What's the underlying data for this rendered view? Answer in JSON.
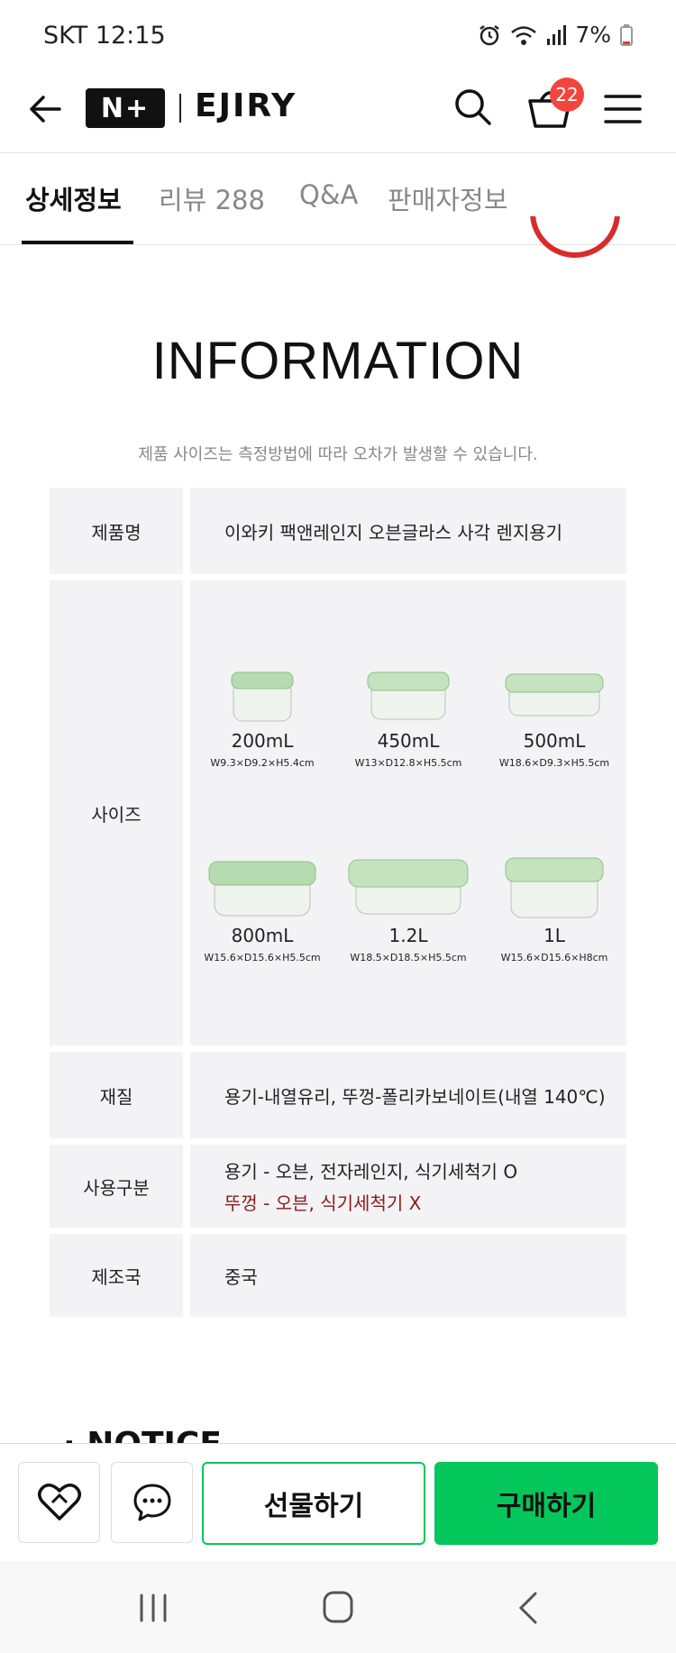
{
  "status": {
    "carrier_time": "SKT 12:15",
    "battery": "7%"
  },
  "header": {
    "brand_badge": "N+",
    "store_name": "EJIRY",
    "cart_count": "22"
  },
  "tabs": [
    {
      "label": "상세정보"
    },
    {
      "label": "리뷰 288"
    },
    {
      "label": "Q&A"
    },
    {
      "label": "판매자정보"
    }
  ],
  "info": {
    "title": "INFORMATION",
    "note": "제품 사이즈는 측정방법에 따라 오차가 발생할 수 있습니다."
  },
  "table": {
    "product_label": "제품명",
    "product_value": "이와키 팩앤레인지 오븐글라스 사각 렌지용기",
    "size_label": "사이즈",
    "sizes": [
      {
        "vol": "200mL",
        "dim": "W9.3×D9.2×H5.4cm"
      },
      {
        "vol": "450mL",
        "dim": "W13×D12.8×H5.5cm"
      },
      {
        "vol": "500mL",
        "dim": "W18.6×D9.3×H5.5cm"
      },
      {
        "vol": "800mL",
        "dim": "W15.6×D15.6×H5.5cm"
      },
      {
        "vol": "1.2L",
        "dim": "W18.5×D18.5×H5.5cm"
      },
      {
        "vol": "1L",
        "dim": "W15.6×D15.6×H8cm"
      }
    ],
    "material_label": "재질",
    "material_value": "용기-내열유리, 뚜껑-폴리카보네이트(내열 140℃)",
    "usage_label": "사용구분",
    "usage_line1": "용기 - 오븐, 전자레인지, 식기세척기 O",
    "usage_line2": "뚜껑 - 오븐, 식기세척기 X",
    "origin_label": "제조국",
    "origin_value": "중국"
  },
  "notice_title": "· NOTICE",
  "bottom": {
    "gift_label": "선물하기",
    "buy_label": "구매하기"
  },
  "colors": {
    "accent_green": "#03c75a",
    "badge_red": "#f2453d",
    "warn_text": "#8b1a1a",
    "table_bg": "#f3f3f5"
  }
}
